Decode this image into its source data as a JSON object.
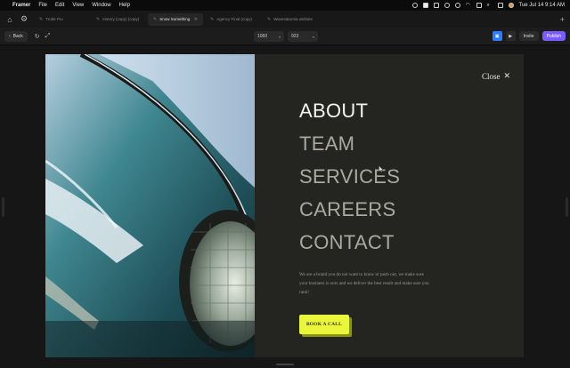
{
  "menubar": {
    "app": "Framer",
    "menus": [
      "File",
      "Edit",
      "View",
      "Window",
      "Help"
    ],
    "clock": "Tue Jul 14  9:14 AM"
  },
  "tabs": [
    {
      "label": "Trutie Pro",
      "active": false
    },
    {
      "label": "Instory (copy) (copy)",
      "active": false
    },
    {
      "label": "Snow Something",
      "active": true
    },
    {
      "label": "Agency Final (copy)",
      "active": false
    },
    {
      "label": "Wavesaturnia website",
      "active": false
    }
  ],
  "toolbar": {
    "back_label": "Back",
    "width_value": "1060",
    "height_value": "923",
    "invite_label": "Invite",
    "publish_label": "Publish"
  },
  "page": {
    "close_label": "Close",
    "nav": [
      "ABOUT",
      "TEAM",
      "SERVICES",
      "CAREERS",
      "CONTACT"
    ],
    "description": "We are a brand you do not want to know or push out, we make sure your business is ours and we deliver the best result and make sure you rank!",
    "cta_label": "BOOK A CALL"
  },
  "colors": {
    "frame_bg": "#242521",
    "nav_active": "#f4f4ee",
    "nav_inactive": "#a9a9a0",
    "cta_bg": "#e9f63c",
    "publish": "#7b5cff",
    "preview_blue": "#2b7cff"
  }
}
